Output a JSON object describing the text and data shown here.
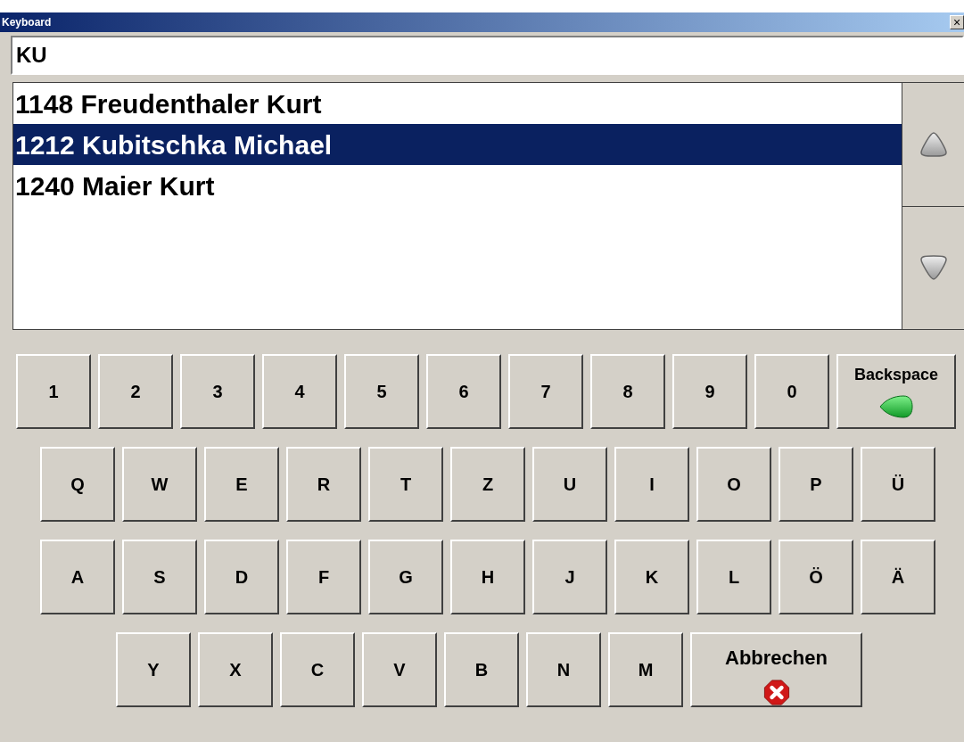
{
  "window": {
    "title": "Keyboard",
    "close": "×"
  },
  "search": {
    "value": "KU"
  },
  "results": [
    {
      "label": "1148 Freudenthaler Kurt",
      "selected": false
    },
    {
      "label": "1212 Kubitschka Michael",
      "selected": true
    },
    {
      "label": "1240 Maier Kurt",
      "selected": false
    }
  ],
  "keyboard_rows": [
    {
      "keys": [
        {
          "kind": "char",
          "label": "1"
        },
        {
          "kind": "char",
          "label": "2"
        },
        {
          "kind": "char",
          "label": "3"
        },
        {
          "kind": "char",
          "label": "4"
        },
        {
          "kind": "char",
          "label": "5"
        },
        {
          "kind": "char",
          "label": "6"
        },
        {
          "kind": "char",
          "label": "7"
        },
        {
          "kind": "char",
          "label": "8"
        },
        {
          "kind": "char",
          "label": "9"
        },
        {
          "kind": "char",
          "label": "0"
        },
        {
          "kind": "backspace",
          "label": "Backspace"
        }
      ]
    },
    {
      "keys": [
        {
          "kind": "char",
          "label": "Q"
        },
        {
          "kind": "char",
          "label": "W"
        },
        {
          "kind": "char",
          "label": "E"
        },
        {
          "kind": "char",
          "label": "R"
        },
        {
          "kind": "char",
          "label": "T"
        },
        {
          "kind": "char",
          "label": "Z"
        },
        {
          "kind": "char",
          "label": "U"
        },
        {
          "kind": "char",
          "label": "I"
        },
        {
          "kind": "char",
          "label": "O"
        },
        {
          "kind": "char",
          "label": "P"
        },
        {
          "kind": "char",
          "label": "Ü"
        }
      ]
    },
    {
      "keys": [
        {
          "kind": "char",
          "label": "A"
        },
        {
          "kind": "char",
          "label": "S"
        },
        {
          "kind": "char",
          "label": "D"
        },
        {
          "kind": "char",
          "label": "F"
        },
        {
          "kind": "char",
          "label": "G"
        },
        {
          "kind": "char",
          "label": "H"
        },
        {
          "kind": "char",
          "label": "J"
        },
        {
          "kind": "char",
          "label": "K"
        },
        {
          "kind": "char",
          "label": "L"
        },
        {
          "kind": "char",
          "label": "Ö"
        },
        {
          "kind": "char",
          "label": "Ä"
        }
      ]
    },
    {
      "keys": [
        {
          "kind": "char",
          "label": "Y"
        },
        {
          "kind": "char",
          "label": "X"
        },
        {
          "kind": "char",
          "label": "C"
        },
        {
          "kind": "char",
          "label": "V"
        },
        {
          "kind": "char",
          "label": "B"
        },
        {
          "kind": "char",
          "label": "N"
        },
        {
          "kind": "char",
          "label": "M"
        },
        {
          "kind": "cancel",
          "label": "Abbrechen"
        }
      ]
    }
  ]
}
